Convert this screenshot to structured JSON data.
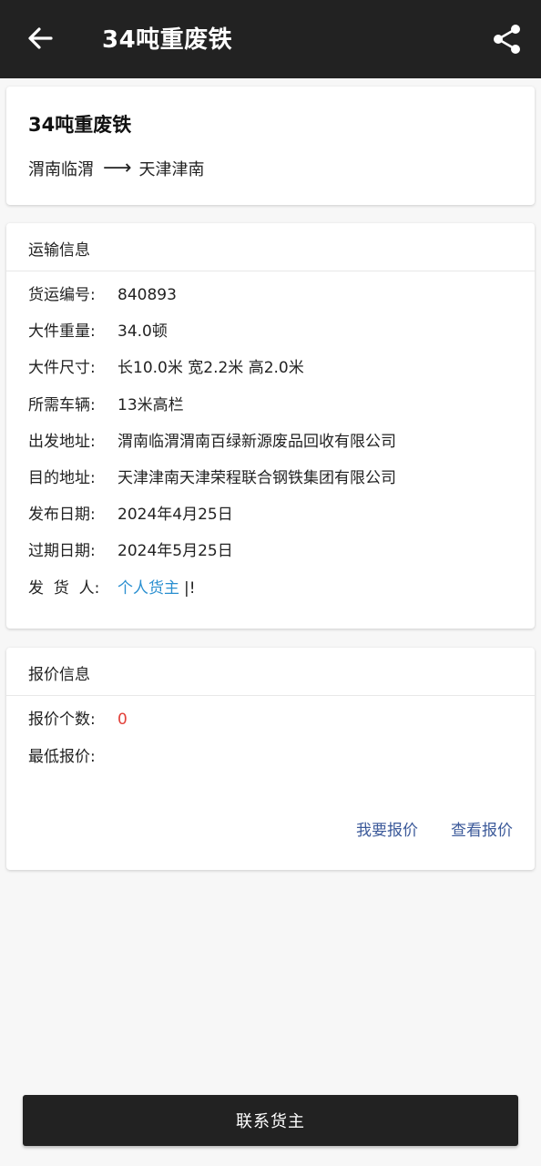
{
  "appbar": {
    "title": "34吨重废铁",
    "back_icon": "arrow-left-icon",
    "share_icon": "share-icon"
  },
  "summary": {
    "title": "34吨重废铁",
    "from": "渭南临渭",
    "arrow": "⟶",
    "to": "天津津南"
  },
  "transport": {
    "header": "运输信息",
    "rows": [
      {
        "label": "货运编号:",
        "value": "840893"
      },
      {
        "label": "大件重量:",
        "value": "34.0顿"
      },
      {
        "label": "大件尺寸:",
        "value": "长10.0米 宽2.2米 高2.0米"
      },
      {
        "label": "所需车辆:",
        "value": "13米高栏"
      },
      {
        "label": "出发地址:",
        "value": "渭南临渭渭南百绿新源废品回收有限公司"
      },
      {
        "label": "目的地址:",
        "value": "天津津南天津荣程联合钢铁集团有限公司"
      },
      {
        "label": "发布日期:",
        "value": "2024年4月25日"
      },
      {
        "label": "过期日期:",
        "value": "2024年5月25日"
      },
      {
        "label": "发  货  人:",
        "value": "个人货主",
        "suffix": "|!"
      }
    ]
  },
  "quote": {
    "header": "报价信息",
    "count_label": "报价个数:",
    "count_value": "0",
    "min_label": "最低报价:",
    "min_value": "",
    "actions": {
      "quote": "我要报价",
      "view": "查看报价"
    }
  },
  "colors": {
    "appbar": "#222222",
    "link": "#2a8fd0",
    "action": "#3c5a9a",
    "count_red": "#e2413a"
  },
  "bottom_button": "联系货主"
}
